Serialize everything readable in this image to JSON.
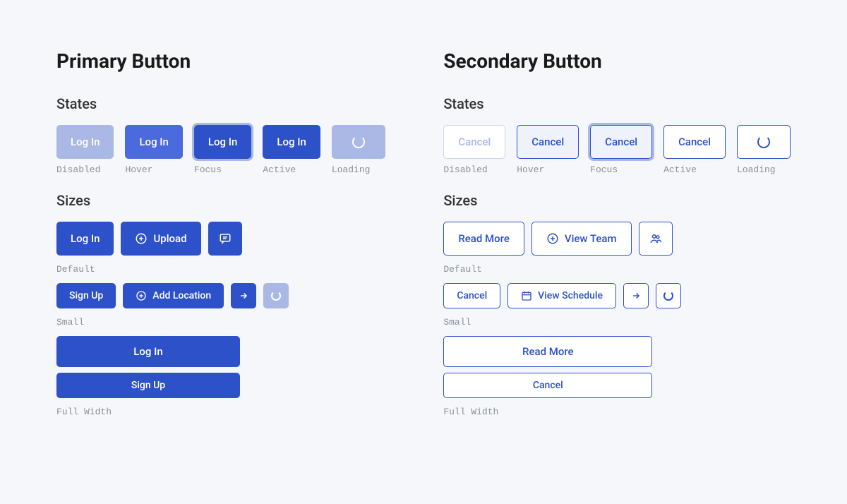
{
  "primary": {
    "title": "Primary Button",
    "states_heading": "States",
    "sizes_heading": "Sizes",
    "states": {
      "disabled": {
        "label": "Log In",
        "caption": "Disabled"
      },
      "hover": {
        "label": "Log In",
        "caption": "Hover"
      },
      "focus": {
        "label": "Log In",
        "caption": "Focus"
      },
      "active": {
        "label": "Log In",
        "caption": "Active"
      },
      "loading": {
        "caption": "Loading"
      }
    },
    "sizes": {
      "default_caption": "Default",
      "small_caption": "Small",
      "full_caption": "Full Width",
      "login": "Log In",
      "upload": "Upload",
      "signup": "Sign Up",
      "add_location": "Add Location",
      "full_login": "Log In",
      "full_signup": "Sign Up"
    }
  },
  "secondary": {
    "title": "Secondary Button",
    "states_heading": "States",
    "sizes_heading": "Sizes",
    "states": {
      "disabled": {
        "label": "Cancel",
        "caption": "Disabled"
      },
      "hover": {
        "label": "Cancel",
        "caption": "Hover"
      },
      "focus": {
        "label": "Cancel",
        "caption": "Focus"
      },
      "active": {
        "label": "Cancel",
        "caption": "Active"
      },
      "loading": {
        "caption": "Loading"
      }
    },
    "sizes": {
      "default_caption": "Default",
      "small_caption": "Small",
      "full_caption": "Full Width",
      "read_more": "Read More",
      "view_team": "View Team",
      "cancel": "Cancel",
      "view_schedule": "View Schedule",
      "full_read_more": "Read More",
      "full_cancel": "Cancel"
    }
  }
}
